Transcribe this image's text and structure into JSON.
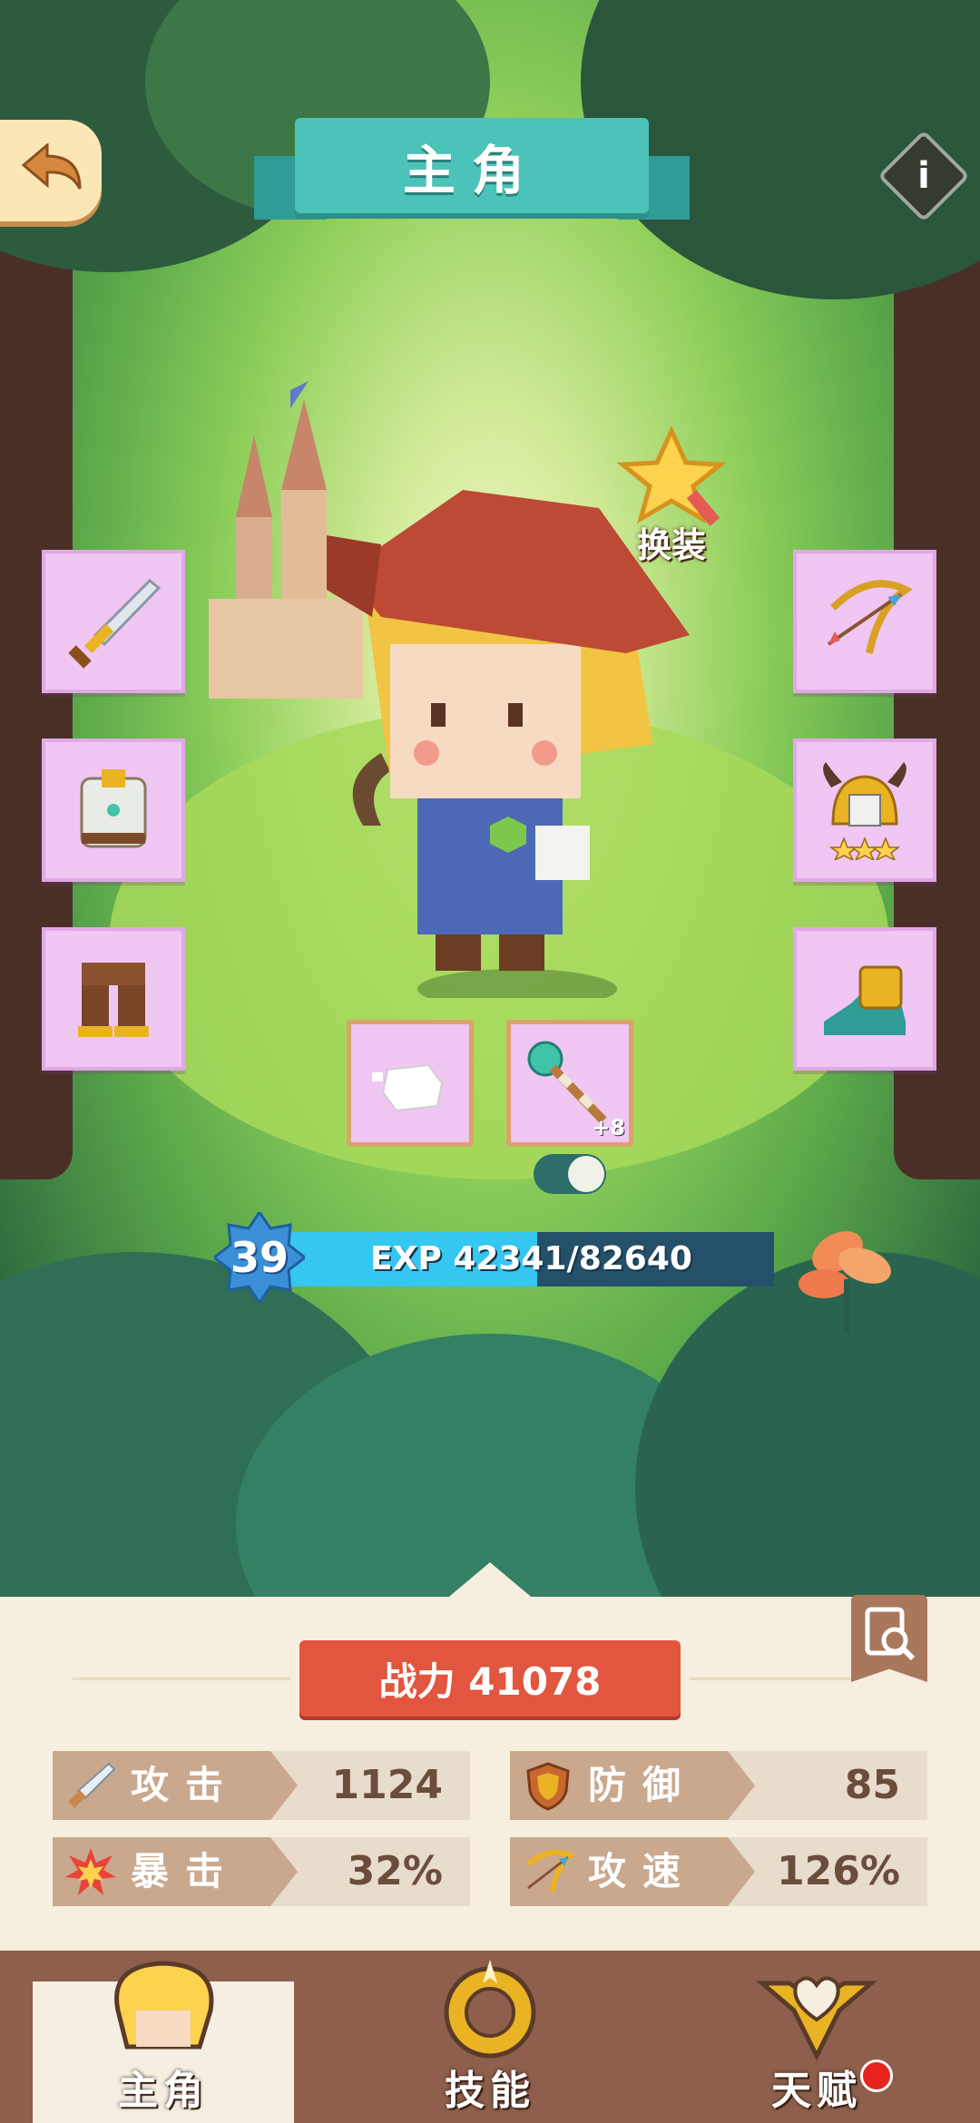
{
  "header": {
    "title": "主角"
  },
  "hero": {
    "change_outfit_label": "换装",
    "level": "39",
    "exp_text": "EXP 42341/82640",
    "exp_progress": 0.512,
    "helmet_stars": 3,
    "weapon_upgrade": "+8"
  },
  "equipment": {
    "left": [
      "sword",
      "armor",
      "pants"
    ],
    "right": [
      "bow",
      "helmet",
      "boots"
    ],
    "extra": [
      "white-pet-block",
      "magic-staff"
    ]
  },
  "stats": {
    "power": "战力 41078",
    "items": [
      {
        "label": "攻击",
        "value": "1124",
        "icon": "sword-icon"
      },
      {
        "label": "防御",
        "value": "85",
        "icon": "shield-icon"
      },
      {
        "label": "暴击",
        "value": "32%",
        "icon": "explosion-icon"
      },
      {
        "label": "攻速",
        "value": "126%",
        "icon": "bow-icon"
      }
    ]
  },
  "nav": {
    "tabs": [
      {
        "label": "主角",
        "active": true
      },
      {
        "label": "技能",
        "active": false
      },
      {
        "label": "天赋",
        "active": false,
        "badge": true
      }
    ]
  },
  "colors": {
    "accent": "#4cc3b8",
    "power": "#e25640",
    "exp": "#35c6f2",
    "slot": "#f0c6f3"
  }
}
